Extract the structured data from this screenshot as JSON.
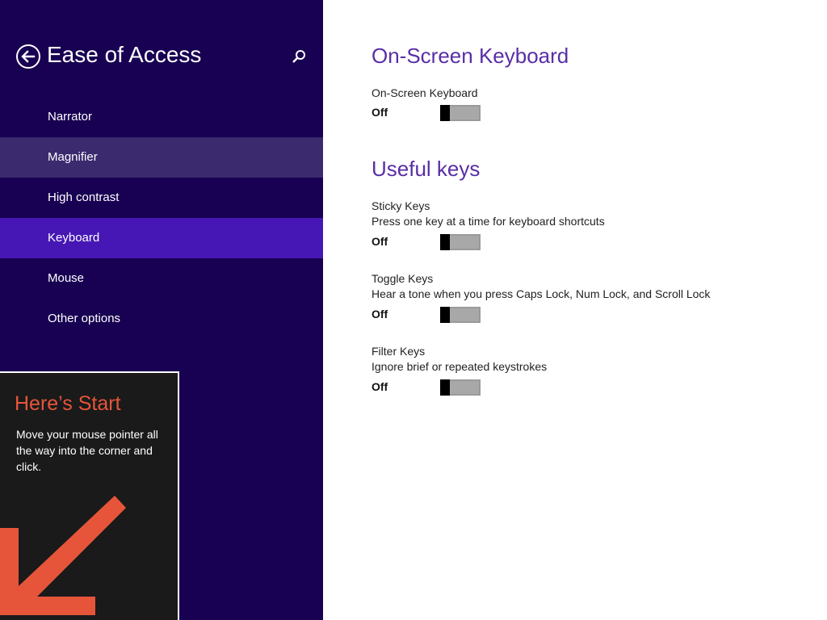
{
  "sidebar": {
    "title": "Ease of Access",
    "items": [
      {
        "label": "Narrator"
      },
      {
        "label": "Magnifier"
      },
      {
        "label": "High contrast"
      },
      {
        "label": "Keyboard"
      },
      {
        "label": "Mouse"
      },
      {
        "label": "Other options"
      }
    ],
    "hovered_item": "Magnifier",
    "selected_item": "Keyboard"
  },
  "start_tip": {
    "title": "Here’s Start",
    "body": "Move your mouse pointer all the way into the corner and click."
  },
  "content": {
    "osk_section": {
      "title": "On-Screen Keyboard",
      "setting": {
        "label": "On-Screen Keyboard",
        "state": "Off",
        "on": false
      }
    },
    "useful_keys_section": {
      "title": "Useful keys",
      "sticky": {
        "label": "Sticky Keys",
        "description": "Press one key at a time for keyboard shortcuts",
        "state": "Off",
        "on": false
      },
      "toggle": {
        "label": "Toggle Keys",
        "description": "Hear a tone when you press Caps Lock, Num Lock, and Scroll Lock",
        "state": "Off",
        "on": false
      },
      "filter": {
        "label": "Filter Keys",
        "description": "Ignore brief or repeated keystrokes",
        "state": "Off",
        "on": false
      }
    }
  },
  "colors": {
    "sidebar_bg": "#180052",
    "selected_bg": "#4617b4",
    "hover_bg": "#3b2a6e",
    "heading_accent": "#5a2ea6",
    "tip_title": "#e6553a",
    "tip_arrow": "#e6553a"
  },
  "icons": {
    "back": "back-arrow-icon",
    "search": "search-icon",
    "tip_arrow": "arrow-down-left-icon"
  }
}
